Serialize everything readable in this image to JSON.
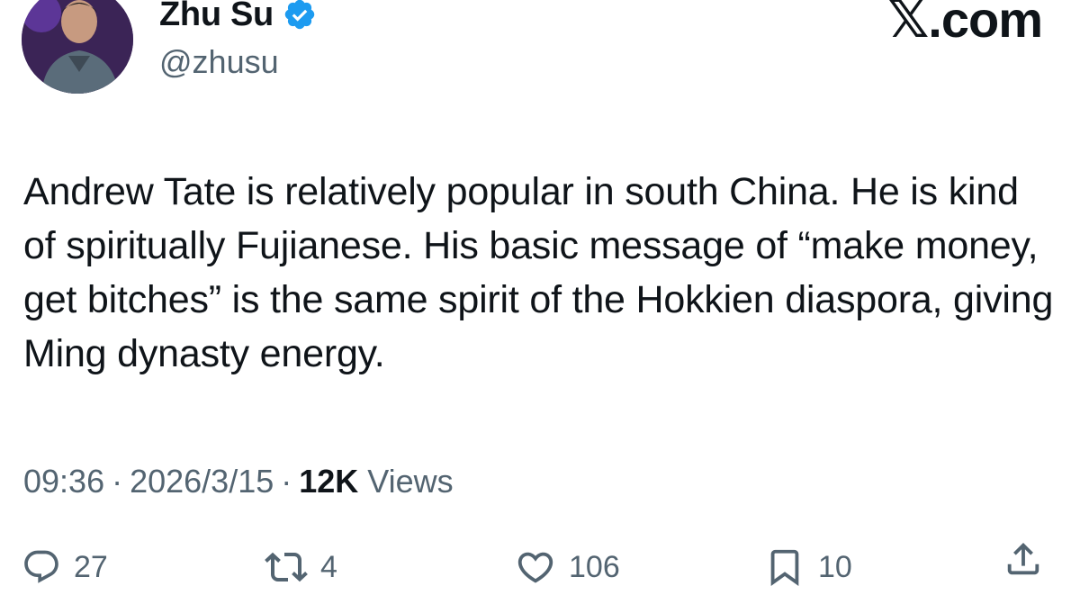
{
  "author": {
    "display_name": "Zhu Su",
    "handle": "@zhusu",
    "verified": true,
    "verified_color": "#1d9bf0"
  },
  "brand": {
    "x_glyph": "𝕏",
    "suffix": ".com"
  },
  "tweet": {
    "text": "Andrew Tate is relatively popular in south China. He is kind of spiritually Fujianese. His basic message of “make money, get bitches” is the same spirit of the Hokkien diaspora, giving Ming dynasty energy."
  },
  "meta": {
    "time": "09:36",
    "separator": "·",
    "date": "2026/3/15",
    "views_count": "12K",
    "views_label": "Views"
  },
  "actions": {
    "reply": {
      "icon": "reply-icon",
      "count": "27"
    },
    "retweet": {
      "icon": "retweet-icon",
      "count": "4"
    },
    "like": {
      "icon": "heart-icon",
      "count": "106"
    },
    "bookmark": {
      "icon": "bookmark-icon",
      "count": "10"
    },
    "share": {
      "icon": "share-icon"
    }
  },
  "colors": {
    "text_primary": "#0f1419",
    "text_secondary": "#536471",
    "accent": "#1d9bf0"
  }
}
